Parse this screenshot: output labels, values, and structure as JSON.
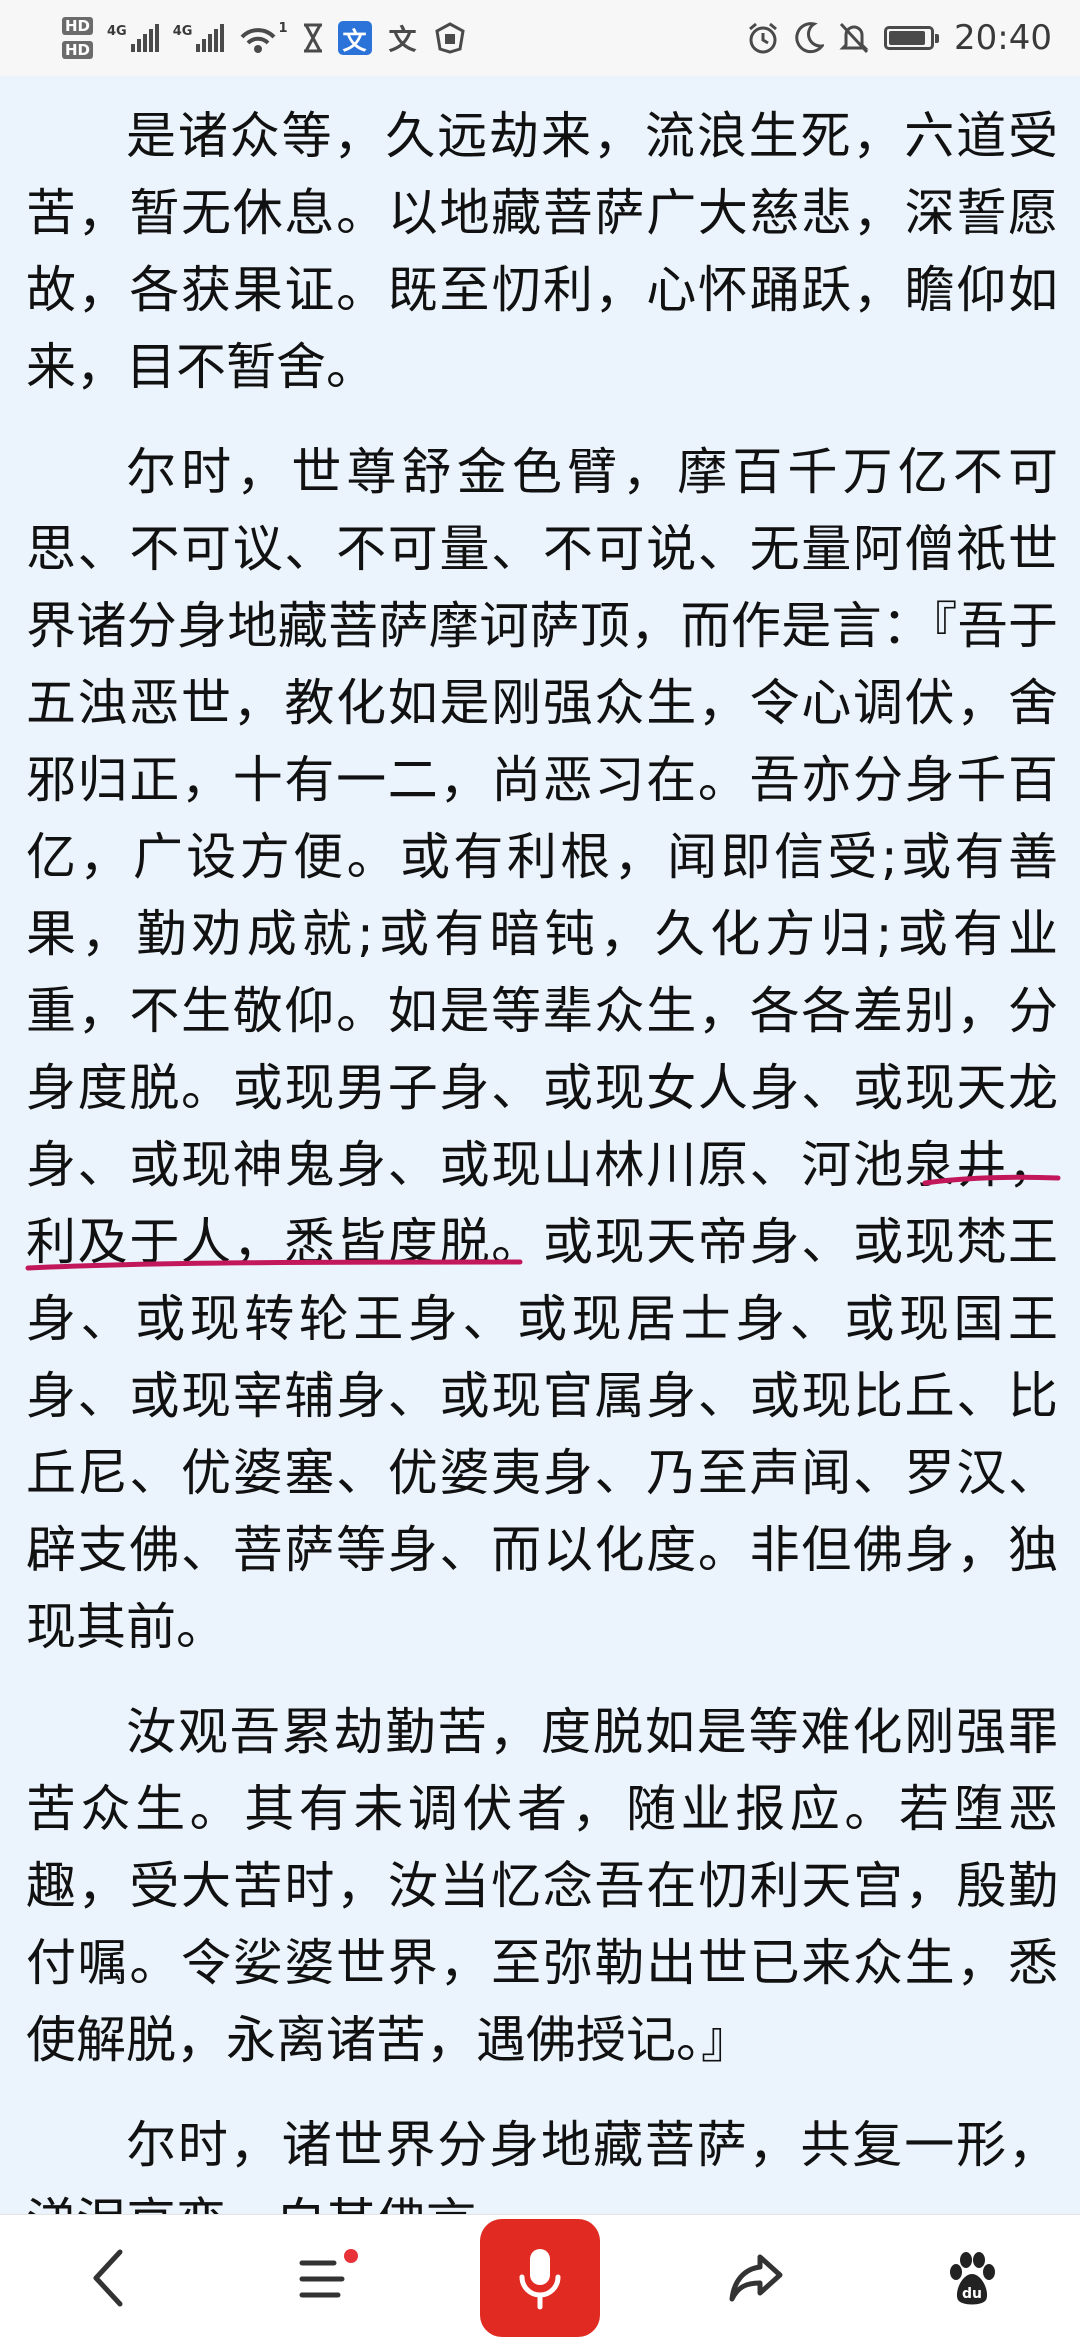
{
  "status_bar": {
    "hd1": "HD",
    "hd2": "HD",
    "sim1_label": "4G",
    "sim2_label": "4G",
    "wifi_badge": "1",
    "time": "20:40",
    "icons": [
      "hd-icon",
      "signal-icon",
      "signal-icon",
      "wifi-icon",
      "hourglass-icon",
      "translate-icon",
      "translate-icon",
      "shield-icon",
      "alarm-icon",
      "moon-icon",
      "mute-icon",
      "battery-icon"
    ]
  },
  "content": {
    "paragraphs": [
      "是诸众等，久远劫来，流浪生死，六道受苦，暂无休息。以地藏菩萨广大慈悲，深誓愿故，各获果证。既至忉利，心怀踊跃，瞻仰如来，目不暂舍。",
      "尔时，世尊舒金色臂，摩百千万亿不可思、不可议、不可量、不可说、无量阿僧祇世界诸分身地藏菩萨摩诃萨顶，而作是言：『吾于五浊恶世，教化如是刚强众生，令心调伏，舍邪归正，十有一二，尚恶习在。吾亦分身千百亿，广设方便。或有利根，闻即信受;或有善果，勤劝成就;或有暗钝，久化方归;或有业重，不生敬仰。如是等辈众生，各各差别，分身度脱。或现男子身、或现女人身、或现天龙身、或现神鬼身、或现山林川原、河池泉井，利及于人，悉皆度脱。或现天帝身、或现梵王身、或现转轮王身、或现居士身、或现国王身、或现宰辅身、或现官属身、或现比丘、比丘尼、优婆塞、优婆夷身、乃至声闻、罗汉、辟支佛、菩萨等身、而以化度。非但佛身，独现其前。",
      "汝观吾累劫勤苦，度脱如是等难化刚强罪苦众生。其有未调伏者，随业报应。若堕恶趣，受大苦时，汝当忆念吾在忉利天宫，殷勤付嘱。令娑婆世界，至弥勒出世已来众生，悉使解脱，永离诸苦，遇佛授记。』",
      "尔时，诸世界分身地藏菩萨，共复一形，涕泪哀恋，白其佛言。"
    ],
    "underline_color": "#c2185b"
  },
  "bottom_nav": {
    "buttons": [
      "back-icon",
      "menu-icon",
      "microphone-icon",
      "share-icon",
      "baidu-paw-icon"
    ],
    "accent": "#e02a22"
  }
}
